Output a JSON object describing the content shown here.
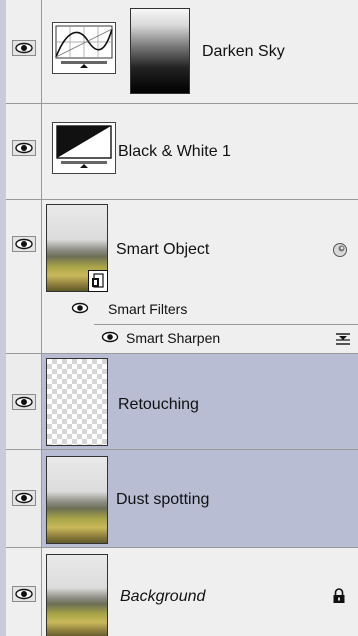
{
  "layers": [
    {
      "label": "Darken Sky",
      "type": "adjustment-curves",
      "selected": false
    },
    {
      "label": "Black & White 1",
      "type": "adjustment-bw",
      "selected": false
    },
    {
      "label": "Smart Object",
      "type": "smart-object",
      "selected": false,
      "filters_label": "Smart Filters",
      "filter_item_label": "Smart Sharpen"
    },
    {
      "label": "Retouching",
      "type": "pixel-transparent",
      "selected": true
    },
    {
      "label": "Dust spotting",
      "type": "pixel-photo",
      "selected": true
    },
    {
      "label": "Background",
      "type": "background",
      "selected": false,
      "italic": true
    }
  ],
  "colors": {
    "panel_bg": "#ececec",
    "selected_bg": "#b8bdd4",
    "divider": "#9a9a9a",
    "accent_strip": "#c9ccd6"
  },
  "icons": {
    "visibility": "eye-icon",
    "smart_object_badge": "smart-object-icon",
    "filter_options": "filter-blending-options-icon",
    "lock": "lock-icon",
    "curves": "curves-adjustment-icon",
    "black_white": "black-white-adjustment-icon"
  }
}
